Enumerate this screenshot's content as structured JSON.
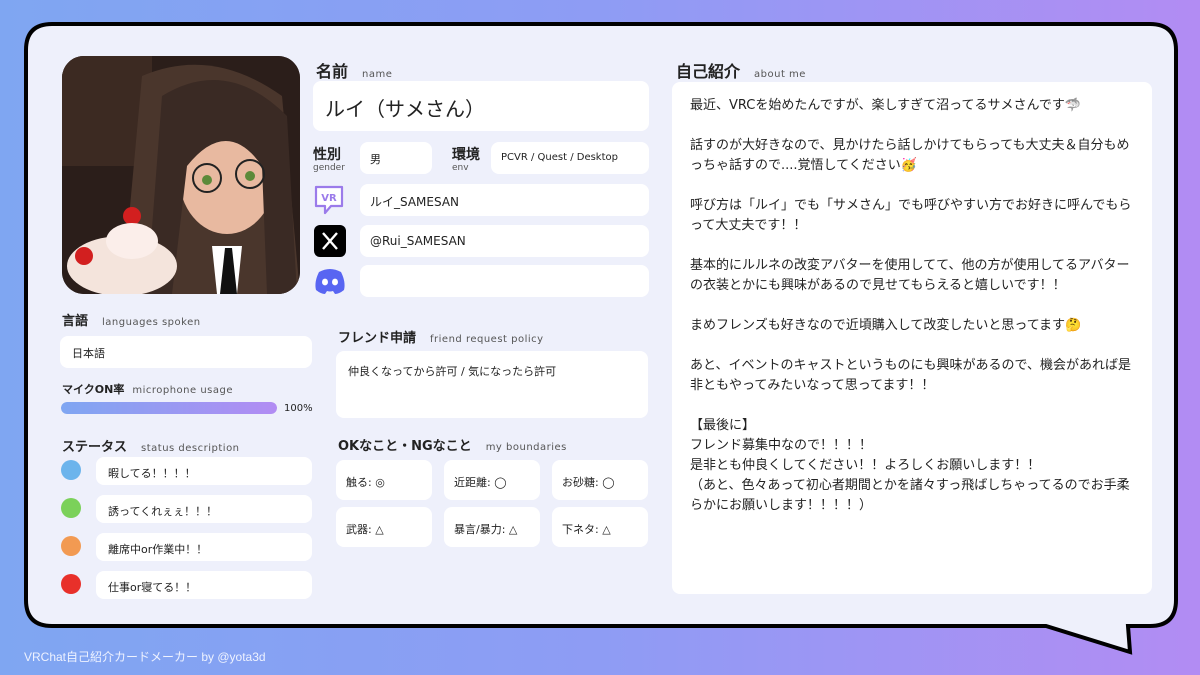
{
  "name_section": {
    "label": "名前",
    "label_en": "name",
    "value": "ルイ（サメさん）"
  },
  "gender": {
    "label": "性別",
    "label_en": "gender",
    "value": "男"
  },
  "env": {
    "label": "環境",
    "label_en": "env",
    "value": "PCVR / Quest / Desktop"
  },
  "social": {
    "vrchat": "ルイ_SAMESAN",
    "x": "@Rui_SAMESAN",
    "discord": ""
  },
  "languages": {
    "label": "言語",
    "label_en": "languages spoken",
    "value": "日本語"
  },
  "mic": {
    "label": "マイクON率",
    "label_en": "microphone usage",
    "value_text": "100%",
    "value": 100
  },
  "status": {
    "label": "ステータス",
    "label_en": "status description",
    "items": [
      {
        "color": "#6cb4ec",
        "text": "暇してる！！！！"
      },
      {
        "color": "#7bd15a",
        "text": "誘ってくれぇぇ！！！"
      },
      {
        "color": "#f29a52",
        "text": "離席中or作業中！！"
      },
      {
        "color": "#e8302a",
        "text": "仕事or寝てる！！"
      }
    ]
  },
  "friend": {
    "label": "フレンド申請",
    "label_en": "friend request policy",
    "value": "仲良くなってから許可 / 気になったら許可"
  },
  "boundaries": {
    "label": "OKなこと・NGなこと",
    "label_en": "my boundaries",
    "items": [
      "触る: ◎",
      "近距離: ◯",
      "お砂糖: ◯",
      "武器: △",
      "暴言/暴力: △",
      "下ネタ: △"
    ]
  },
  "about": {
    "label": "自己紹介",
    "label_en": "about me",
    "paragraphs": [
      "最近、VRCを始めたんですが、楽しすぎて沼ってるサメさんです🦈",
      "話すのが大好きなので、見かけたら話しかけてもらっても大丈夫＆自分もめっちゃ話すので....覚悟してください🥳",
      "呼び方は「ルイ」でも「サメさん」でも呼びやすい方でお好きに呼んでもらって大丈夫です！！",
      "基本的にルルネの改変アバターを使用してて、他の方が使用してるアバターの衣装とかにも興味があるので見せてもらえると嬉しいです！！",
      "まめフレンズも好きなので近頃購入して改変したいと思ってます🤔",
      "あと、イベントのキャストというものにも興味があるので、機会があれば是非ともやってみたいなって思ってます！！",
      "【最後に】\nフレンド募集中なので！！！！\n是非とも仲良くしてください！！よろしくお願いします！！\n（あと、色々あって初心者期間とかを諸々すっ飛ばしちゃってるのでお手柔らかにお願いします！！！！）"
    ]
  },
  "footer": "VRChat自己紹介カードメーカー by @yota3d"
}
